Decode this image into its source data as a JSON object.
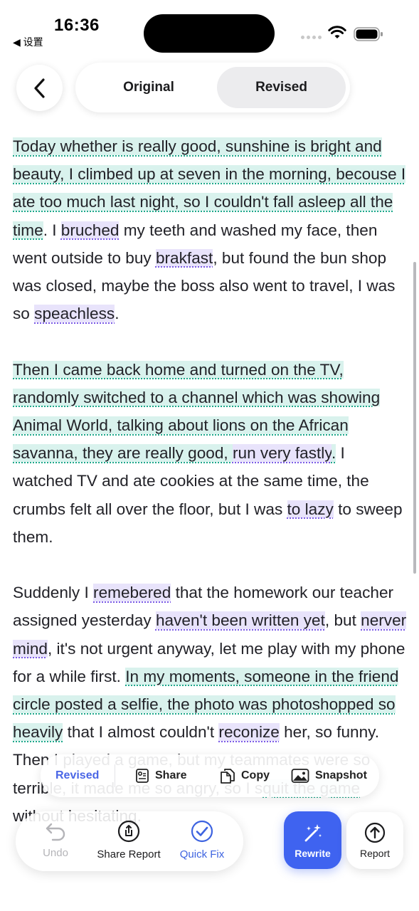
{
  "status_bar": {
    "time": "16:36",
    "back_app": "◀ 设置"
  },
  "tabs": {
    "original": "Original",
    "revised": "Revised"
  },
  "article": {
    "paragraphs": [
      [
        {
          "t": "Today whether is really good, sunshine is bright and beauty, I climbed up at seven in the morning, becouse I ate too much last night, so I couldn't fall asleep all the time",
          "c": "g"
        },
        {
          "t": ". I ",
          "c": ""
        },
        {
          "t": "bruched",
          "c": "s"
        },
        {
          "t": " my teeth and washed my face, then went outside to buy ",
          "c": ""
        },
        {
          "t": "brakfast",
          "c": "s"
        },
        {
          "t": ", but found the bun shop was closed, maybe the boss also went to travel, I was so ",
          "c": ""
        },
        {
          "t": "speachless",
          "c": "s"
        },
        {
          "t": ".",
          "c": ""
        }
      ],
      [
        {
          "t": "Then I came back home and turned on the TV, randomly switched to a channel which was showing Animal World, talking about lions on the African savanna, they are really good, ",
          "c": "g"
        },
        {
          "t": "run very fastly",
          "c": "s"
        },
        {
          "t": ".",
          "c": "g"
        },
        {
          "t": " I watched TV and ate cookies at the same time, the crumbs felt all over the floor, but I was ",
          "c": ""
        },
        {
          "t": "to lazy",
          "c": "s"
        },
        {
          "t": " to sweep them.",
          "c": ""
        }
      ],
      [
        {
          "t": "Suddenly I ",
          "c": ""
        },
        {
          "t": "remebered",
          "c": "s"
        },
        {
          "t": " that the homework our teacher assigned yesterday ",
          "c": ""
        },
        {
          "t": "haven't been written yet",
          "c": "s"
        },
        {
          "t": ", but ",
          "c": ""
        },
        {
          "t": "nerver mind",
          "c": "s"
        },
        {
          "t": ", it's not urgent anyway, let me play with my phone for a while first. ",
          "c": ""
        },
        {
          "t": "In my moments, someone in the friend circle posted a selfie, the photo was photoshopped so heavily",
          "c": "g"
        },
        {
          "t": " that I almost couldn't ",
          "c": ""
        },
        {
          "t": "reconize",
          "c": "s"
        },
        {
          "t": " her, so funny. Then I played a game, but my teammates were so terrible, it made me so angry, so I s",
          "c": ""
        },
        {
          "t": "quit the game",
          "c": "g"
        },
        {
          "t": " without hesitating.",
          "c": ""
        }
      ]
    ]
  },
  "action_bar": {
    "revised": "Revised",
    "share": "Share",
    "copy": "Copy",
    "snapshot": "Snapshot"
  },
  "toolbar": {
    "undo": "Undo",
    "share_report": "Share Report",
    "quick_fix": "Quick Fix",
    "rewrite": "Rewrite",
    "report": "Report"
  },
  "colors": {
    "grammar_highlight": "#d9f2ed",
    "grammar_underline": "#1ea88b",
    "spelling_highlight": "#e8e3fb",
    "spelling_underline": "#7c5ce6",
    "accent_blue": "#3f63f0"
  }
}
